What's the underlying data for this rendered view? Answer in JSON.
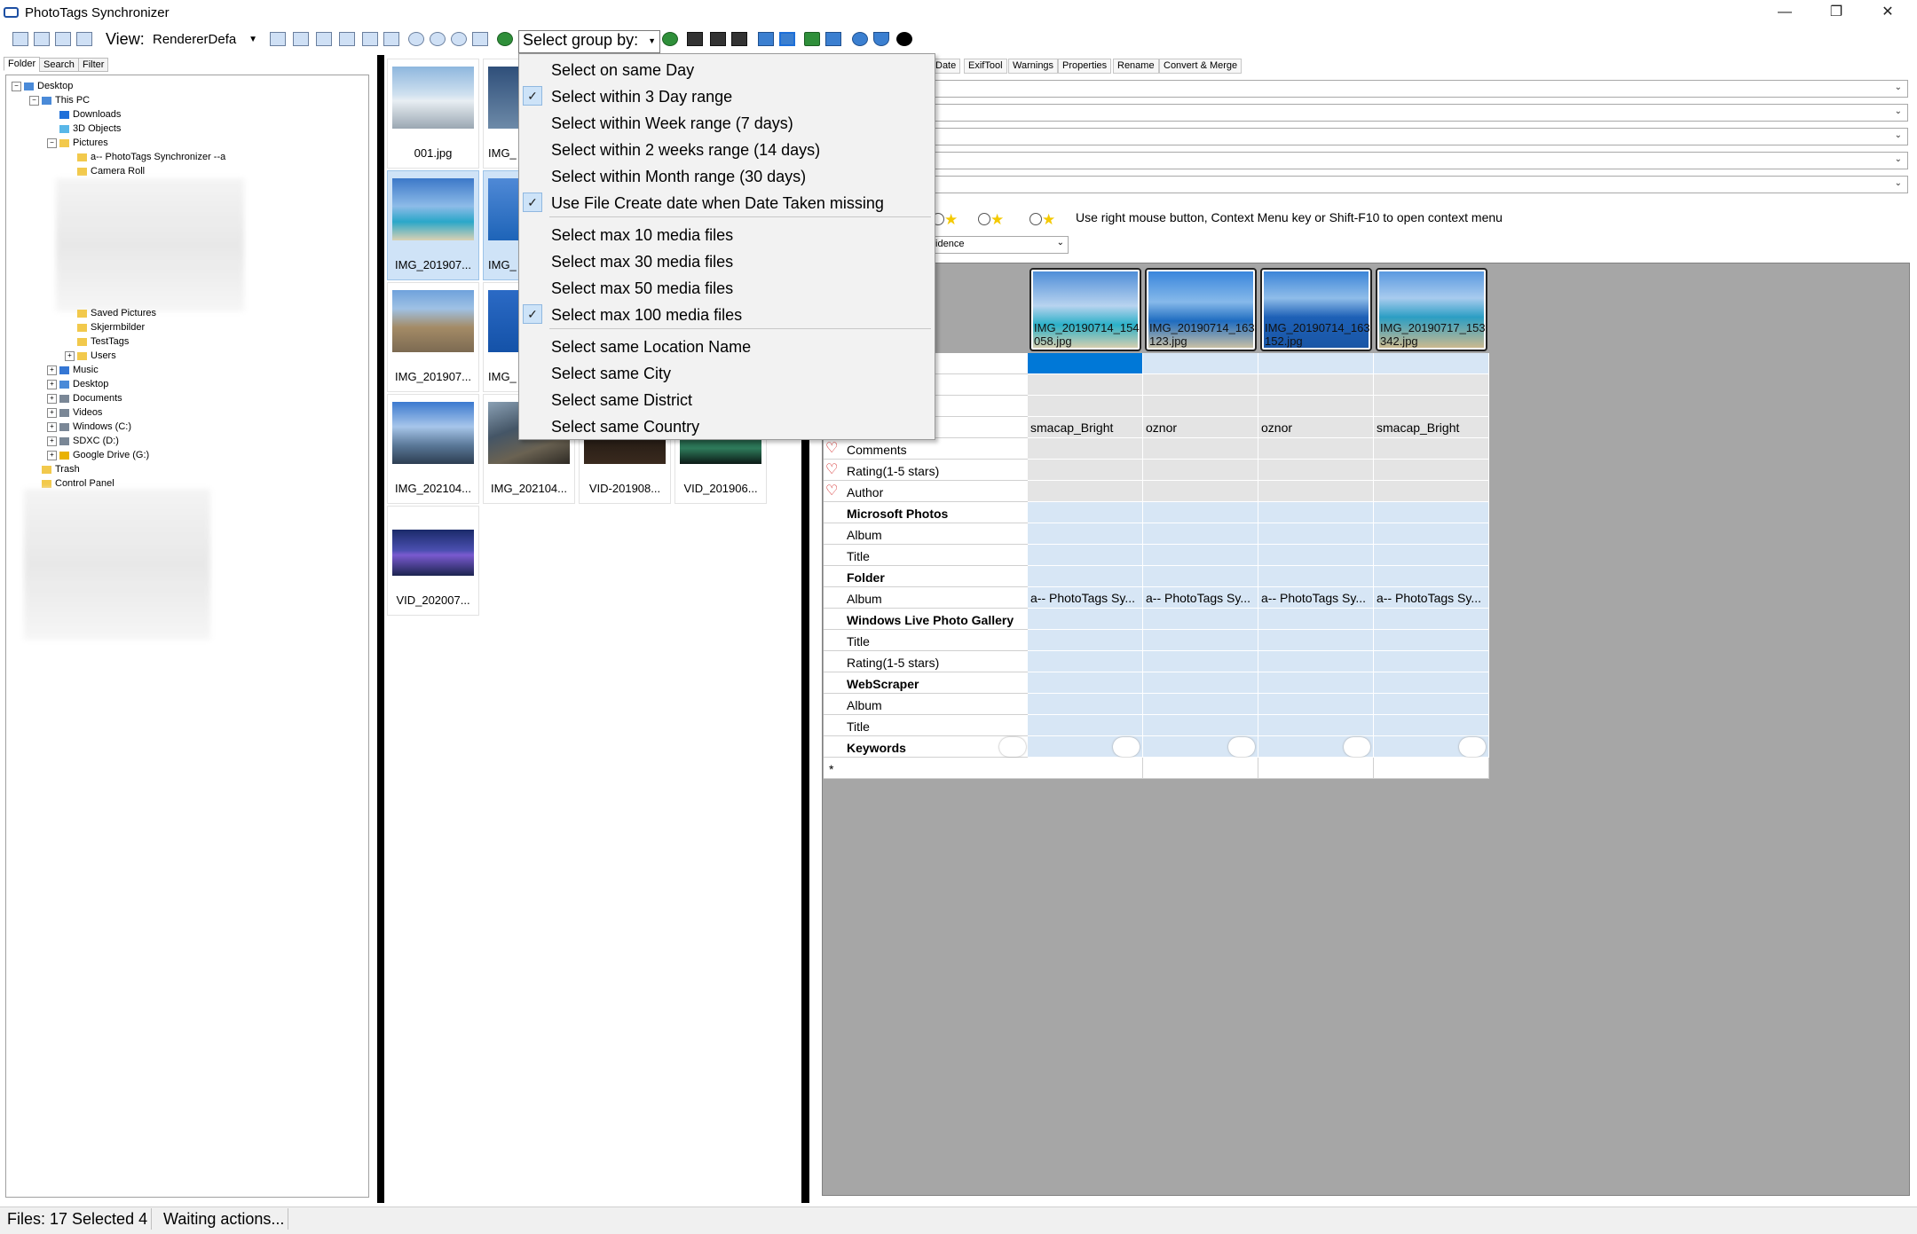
{
  "window": {
    "title": "PhotoTags Synchronizer",
    "minimize": "—",
    "restore": "❐",
    "close": "✕"
  },
  "toolbar": {
    "view_label": "View:",
    "view_value": "RendererDefa",
    "group_by_label": "Select group by:"
  },
  "group_menu": {
    "items": [
      {
        "label": "Select on same Day",
        "checked": false
      },
      {
        "label": "Select within 3 Day range",
        "checked": true
      },
      {
        "label": "Select within Week range (7 days)",
        "checked": false
      },
      {
        "label": "Select within 2 weeks range (14 days)",
        "checked": false
      },
      {
        "label": "Select within Month range (30 days)",
        "checked": false
      },
      {
        "label": "Use File Create date when Date Taken missing",
        "checked": true
      },
      {
        "label": "Select max 10 media files",
        "checked": false
      },
      {
        "label": "Select max 30 media files",
        "checked": false
      },
      {
        "label": "Select max 50 media files",
        "checked": false
      },
      {
        "label": "Select max 100 media files",
        "checked": true
      },
      {
        "label": "Select same Location Name",
        "checked": false
      },
      {
        "label": "Select same City",
        "checked": false
      },
      {
        "label": "Select same District",
        "checked": false
      },
      {
        "label": "Select same Country",
        "checked": false
      }
    ],
    "check_glyph": "✓"
  },
  "left_tabs": [
    "Folder",
    "Search",
    "Filter"
  ],
  "tree": {
    "desktop": "Desktop",
    "this_pc": "This PC",
    "downloads": "Downloads",
    "objects_3d": "3D Objects",
    "pictures": "Pictures",
    "phototags": "a-- PhotoTags Synchronizer --a",
    "camera_roll": "Camera Roll",
    "saved_pictures": "Saved Pictures",
    "skjermbilder": "Skjermbilder",
    "testtags": "TestTags",
    "users": "Users",
    "music": "Music",
    "desktop2": "Desktop",
    "documents": "Documents",
    "videos": "Videos",
    "windows_c": "Windows (C:)",
    "sdxc_d": "SDXC (D:)",
    "google_drive": "Google Drive (G:)",
    "trash": "Trash",
    "control_panel": "Control Panel",
    "plus": "+",
    "minus": "−"
  },
  "thumbs": [
    {
      "caption": "001.jpg"
    },
    {
      "caption": "IMG_"
    },
    {
      "caption": "IMG_201907..."
    },
    {
      "caption": "IMG_"
    },
    {
      "caption": "IMG_201907..."
    },
    {
      "caption": "IMG_"
    },
    {
      "caption": "IMG_202104..."
    },
    {
      "caption": "IMG_202104..."
    },
    {
      "caption": "VID-201908..."
    },
    {
      "caption": "VID_201906..."
    },
    {
      "caption": "VID_202007..."
    }
  ],
  "right_tabs": [
    "Date",
    "ExifTool",
    "Warnings",
    "Properties",
    "Rename",
    "Convert & Merge"
  ],
  "rating_help": "Use right mouse button, Context Menu key or Shift-F10 to open context menu",
  "confidence_combo": "fidence",
  "grid": {
    "columns": [
      {
        "file": "IMG_20190714_154058.jpg",
        "device": "smacap_Bright",
        "folder_album": "a-- PhotoTags Sy..."
      },
      {
        "file": "IMG_20190714_163123.jpg",
        "device": "oznor",
        "folder_album": "a-- PhotoTags Sy..."
      },
      {
        "file": "IMG_20190714_163152.jpg",
        "device": "oznor",
        "folder_album": "a-- PhotoTags Sy..."
      },
      {
        "file": "IMG_20190717_153342.jpg",
        "device": "smacap_Bright",
        "folder_album": "a-- PhotoTags Sy..."
      }
    ],
    "rows": {
      "comments": "Comments",
      "rating": "Rating(1-5 stars)",
      "author": "Author",
      "microsoft_photos": "Microsoft Photos",
      "mp_album": "Album",
      "mp_title": "Title",
      "folder": "Folder",
      "f_album": "Album",
      "wlpg": "Windows Live Photo Gallery",
      "wlpg_title": "Title",
      "wlpg_rating": "Rating(1-5 stars)",
      "webscraper": "WebScraper",
      "ws_album": "Album",
      "ws_title": "Title",
      "keywords": "Keywords",
      "new_row": "*"
    }
  },
  "status": {
    "files": "Files: 17 Selected 4",
    "message": "Waiting actions..."
  },
  "colors": {
    "selection_blue": "#0078d7",
    "cell_blue": "#d7e6f5",
    "heart_red": "#d01818"
  }
}
